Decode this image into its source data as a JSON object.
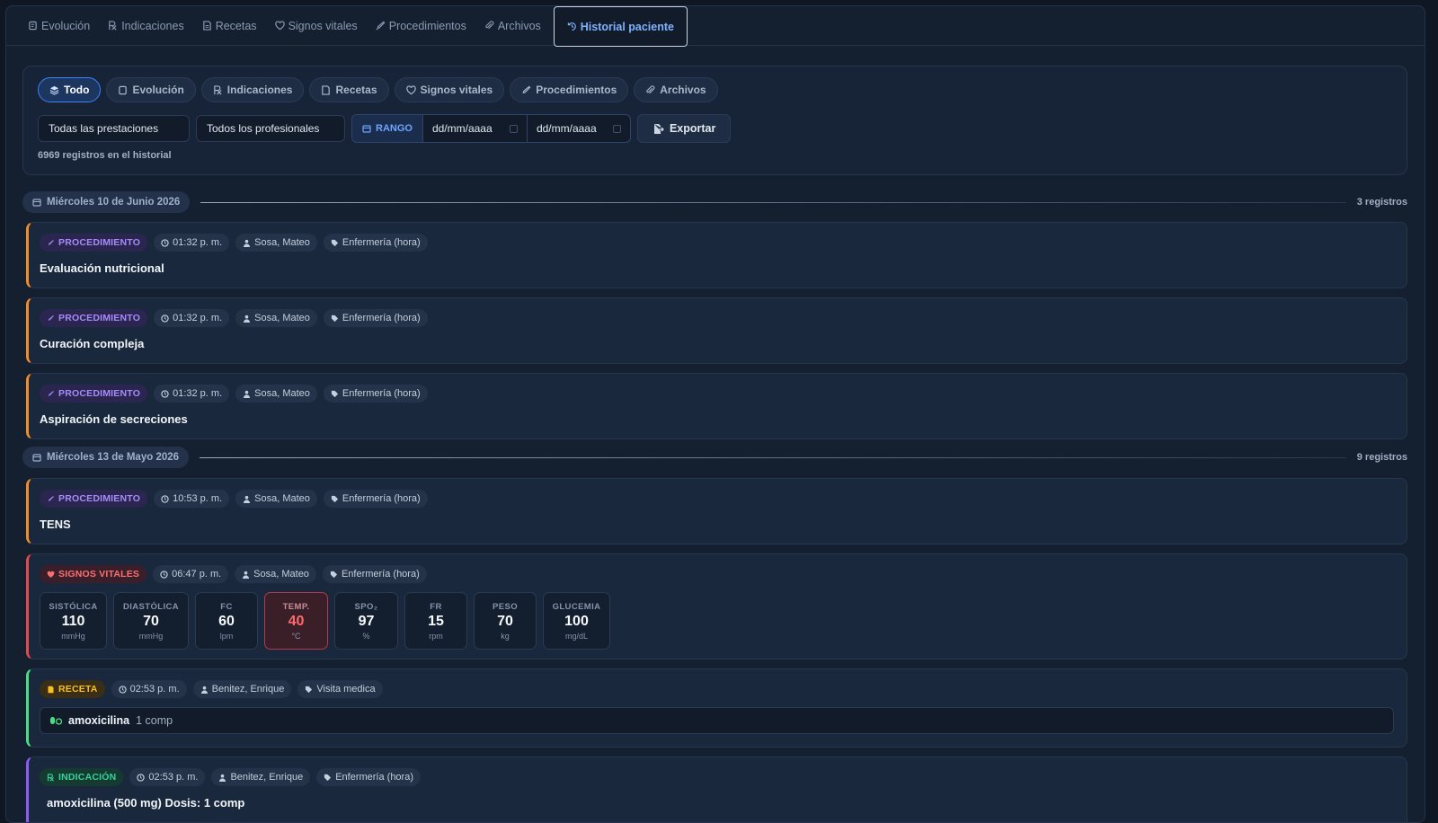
{
  "tabs": [
    {
      "label": "Evolución",
      "icon": "notes-icon"
    },
    {
      "label": "Indicaciones",
      "icon": "rx-icon"
    },
    {
      "label": "Recetas",
      "icon": "prescription-icon"
    },
    {
      "label": "Signos vitales",
      "icon": "heart-icon"
    },
    {
      "label": "Procedimientos",
      "icon": "syringe-icon"
    },
    {
      "label": "Archivos",
      "icon": "paperclip-icon"
    },
    {
      "label": "Historial paciente",
      "icon": "history-icon",
      "active": true
    }
  ],
  "filters": {
    "chips": [
      {
        "label": "Todo",
        "active": true
      },
      {
        "label": "Evolución"
      },
      {
        "label": "Indicaciones"
      },
      {
        "label": "Recetas"
      },
      {
        "label": "Signos vitales"
      },
      {
        "label": "Procedimientos"
      },
      {
        "label": "Archivos"
      }
    ],
    "prestaciones": "Todas las prestaciones",
    "profesionales": "Todos los profesionales",
    "range_label": "RANGO",
    "date_from": "dd/mm/aaaa",
    "date_to": "dd/mm/aaaa",
    "export_label": "Exportar",
    "count_text": "6969 registros en el historial"
  },
  "groups": [
    {
      "date": "Miércoles 10 de Junio 2026",
      "count": "3 registros"
    },
    {
      "date": "Miércoles 13 de Mayo 2026",
      "count": "9 registros"
    }
  ],
  "entries": [
    {
      "type": "PROCEDIMIENTO",
      "time": "01:32 p. m.",
      "professional": "Sosa, Mateo",
      "service": "Enfermería (hora)",
      "title": "Evaluación nutricional"
    },
    {
      "type": "PROCEDIMIENTO",
      "time": "01:32 p. m.",
      "professional": "Sosa, Mateo",
      "service": "Enfermería (hora)",
      "title": "Curación compleja"
    },
    {
      "type": "PROCEDIMIENTO",
      "time": "01:32 p. m.",
      "professional": "Sosa, Mateo",
      "service": "Enfermería (hora)",
      "title": "Aspiración de secreciones"
    },
    {
      "type": "PROCEDIMIENTO",
      "time": "10:53 p. m.",
      "professional": "Sosa, Mateo",
      "service": "Enfermería (hora)",
      "title": "TENS"
    },
    {
      "type": "SIGNOS VITALES",
      "time": "06:47 p. m.",
      "professional": "Sosa, Mateo",
      "service": "Enfermería (hora)",
      "vitals": [
        {
          "label": "SISTÓLICA",
          "value": "110",
          "unit": "mmHg"
        },
        {
          "label": "DIASTÓLICA",
          "value": "70",
          "unit": "mmHg"
        },
        {
          "label": "FC",
          "value": "60",
          "unit": "lpm"
        },
        {
          "label": "TEMP.",
          "value": "40",
          "unit": "°C",
          "alert": true
        },
        {
          "label": "SPO₂",
          "value": "97",
          "unit": "%"
        },
        {
          "label": "FR",
          "value": "15",
          "unit": "rpm"
        },
        {
          "label": "PESO",
          "value": "70",
          "unit": "kg"
        },
        {
          "label": "GLUCEMIA",
          "value": "100",
          "unit": "mg/dL"
        }
      ]
    },
    {
      "type": "RECETA",
      "time": "02:53 p. m.",
      "professional": "Benitez, Enrique",
      "service": "Visita medica",
      "drug": "amoxicilina",
      "dose": "1 comp"
    },
    {
      "type": "INDICACIÓN",
      "time": "02:53 p. m.",
      "professional": "Benitez, Enrique",
      "service": "Enfermería (hora)",
      "title": "amoxicilina (500 mg) Dosis: 1 comp"
    }
  ],
  "colors": {
    "accent": "#3b82f6",
    "procedure": "#f28c28",
    "vitals": "#e5484d",
    "recipe": "#4ade80",
    "indication": "#8b5cf6"
  }
}
